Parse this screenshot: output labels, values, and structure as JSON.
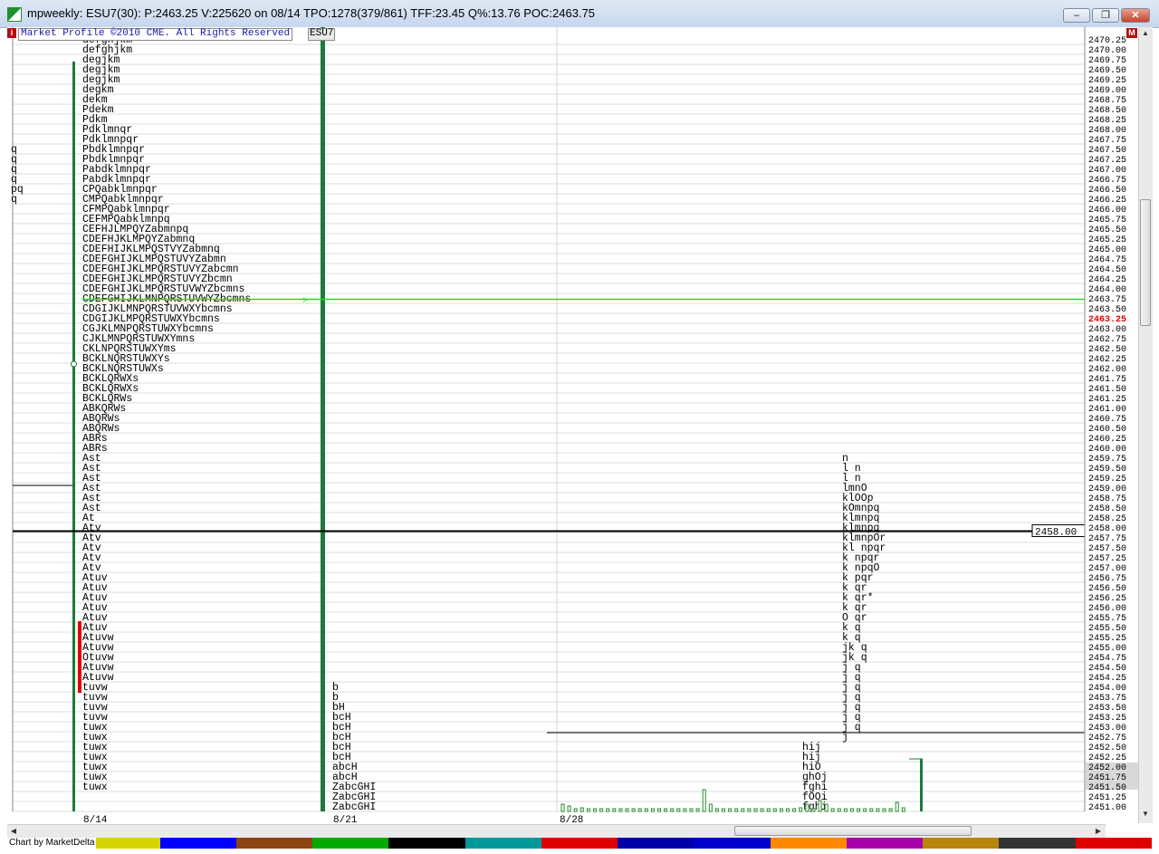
{
  "window": {
    "title": "mpweekly: ESU7(30): P:2463.25 V:225620 on 08/14 TPO:1278(379/861) TFF:23.45 Q%:13.76 POC:2463.75",
    "minimize_label": "–",
    "restore_label": "❐",
    "close_label": "✕"
  },
  "chart": {
    "copyright": "Market Profile ©2010 CME. All Rights Reserved",
    "symbol": "ESU7",
    "corner_left": "i",
    "corner_right": "M",
    "footer_label": "Chart by MarketDelta",
    "current_price_label": "2458.00",
    "highlight_price_label": "2463.25",
    "date_labels": [
      "8/14",
      "8/21",
      "8/28"
    ],
    "price_ticks": [
      "2470.25",
      "2470.00",
      "2469.75",
      "2469.50",
      "2469.25",
      "2469.00",
      "2468.75",
      "2468.50",
      "2468.25",
      "2468.00",
      "2467.75",
      "2467.50",
      "2467.25",
      "2467.00",
      "2466.75",
      "2466.50",
      "2466.25",
      "2466.00",
      "2465.75",
      "2465.50",
      "2465.25",
      "2465.00",
      "2464.75",
      "2464.50",
      "2464.25",
      "2464.00",
      "2463.75",
      "2463.50",
      "2463.25",
      "2463.00",
      "2462.75",
      "2462.50",
      "2462.25",
      "2462.00",
      "2461.75",
      "2461.50",
      "2461.25",
      "2461.00",
      "2460.75",
      "2460.50",
      "2460.25",
      "2460.00",
      "2459.75",
      "2459.50",
      "2459.25",
      "2459.00",
      "2458.75",
      "2458.50",
      "2458.25",
      "2458.00",
      "2457.75",
      "2457.50",
      "2457.25",
      "2457.00",
      "2456.75",
      "2456.50",
      "2456.25",
      "2456.00",
      "2455.75",
      "2455.50",
      "2455.25",
      "2455.00",
      "2454.75",
      "2454.50",
      "2454.25",
      "2454.00",
      "2453.75",
      "2453.50",
      "2453.25",
      "2453.00",
      "2452.75",
      "2452.50",
      "2452.25",
      "2452.00",
      "2451.75",
      "2451.50",
      "2451.25",
      "2451.00"
    ],
    "prior_profile": [
      "q",
      "q",
      "q",
      "q",
      "pq",
      "q"
    ],
    "profile_814": [
      "defghjkm",
      "defghjkm",
      "degjkm",
      "degjkm",
      "degjkm",
      "degkm",
      "dekm",
      "Pdekm",
      "Pdkm",
      "Pdklmnqr",
      "Pdklmnpqr",
      "Pbdklmnpqr",
      "Pbdklmnpqr",
      "Pabdklmnpqr",
      "Pabdklmnpqr",
      "CPQabklmnpqr",
      "CMPQabklmnpqr",
      "CFMPQabklmnpqr",
      "CEFMPQabklmnpq",
      "CEFHJLMPQYZabmnpq",
      "CDEFHJKLMPQYZabmnq",
      "CDEFHIJKLMPQSTVYZabmnq",
      "CDEFGHIJKLMPQSTUVYZabmn",
      "CDEFGHIJKLMPQRSTUVYZabcmn",
      "CDEFGHIJKLMPQRSTUVYZbcmn",
      "CDEFGHIJKLMPQRSTUVWYZbcmns",
      "CDEFGHIJKLMNPQRSTUVWYZbcmns",
      "CDGIJKLMNPQRSTUVWXYbcmns",
      "CDGIJKLMPQRSTUWXYbcmns",
      "CGJKLMNPQRSTUWXYbcmns",
      "CJKLMNPQRSTUWXYmns",
      "CKLNPQRSTUWXYms",
      "BCKLNQRSTUWXYs",
      "BCKLNQRSTUWXs",
      "BCKLQRWXs",
      "BCKLQRWXs",
      "BCKLQRWs",
      "ABKQRWs",
      "ABQRWs",
      "ABQRWs",
      "ABRs",
      "ABRs",
      "Ast",
      "Ast",
      "Ast",
      "Ast",
      "Ast",
      "Ast",
      "At",
      "Atv",
      "Atv",
      "Atv",
      "Atv",
      "Atv",
      "Atuv",
      "Atuv",
      "Atuv",
      "Atuv",
      "Atuv",
      "Atuv",
      "Atuvw",
      "Atuvw",
      "Otuvw",
      "Atuvw",
      "Atuvw",
      "tuvw",
      "tuvw",
      "tuvw",
      "tuvw",
      "tuwx",
      "tuwx",
      "tuwx",
      "tuwx",
      "tuwx",
      "tuwx",
      "tuwx"
    ],
    "profile_821": [
      "b",
      "b",
      "bH",
      "bcH",
      "bcH",
      "bcH",
      "bcH",
      "bcH",
      "abcH",
      "abcH",
      "ZabcGHI",
      "ZabcGHI",
      "ZabcGHI"
    ],
    "profile_828_left": [
      "hij",
      "hij",
      "hiO",
      "ghOj",
      "fghi",
      "fOOi",
      "fghi"
    ],
    "profile_828_right": [
      "n",
      "l n",
      "l n",
      "lmnO",
      "klOOp",
      "kOmnpq",
      "klmnpq",
      "klmnpq",
      "klmnpOr",
      "kl npqr",
      "k npqr",
      "k npqO",
      "k pqr",
      "k qr",
      "k qr*",
      "k qr",
      "O qr",
      "k q",
      "k q",
      "jk q",
      "jk q",
      "j q",
      "j q",
      "j q",
      "j q",
      "j q",
      "j q",
      "j q",
      "j"
    ],
    "colors": {
      "profile_text": "#000000",
      "poc_line": "#22dd22",
      "value_area_bar": "#1e7a3c",
      "initial_balance": "#e00000",
      "current_price": "#000000",
      "highlight_price": "#e00000"
    },
    "footer_colors": [
      "#ffffff",
      "#d4d400",
      "#0000ff",
      "#8b4513",
      "#00aa00",
      "#000000",
      "#009999",
      "#e00000",
      "#0000aa",
      "#0000cc",
      "#ff8800",
      "#aa00aa",
      "#b8860b",
      "#333333",
      "#e00000"
    ]
  }
}
